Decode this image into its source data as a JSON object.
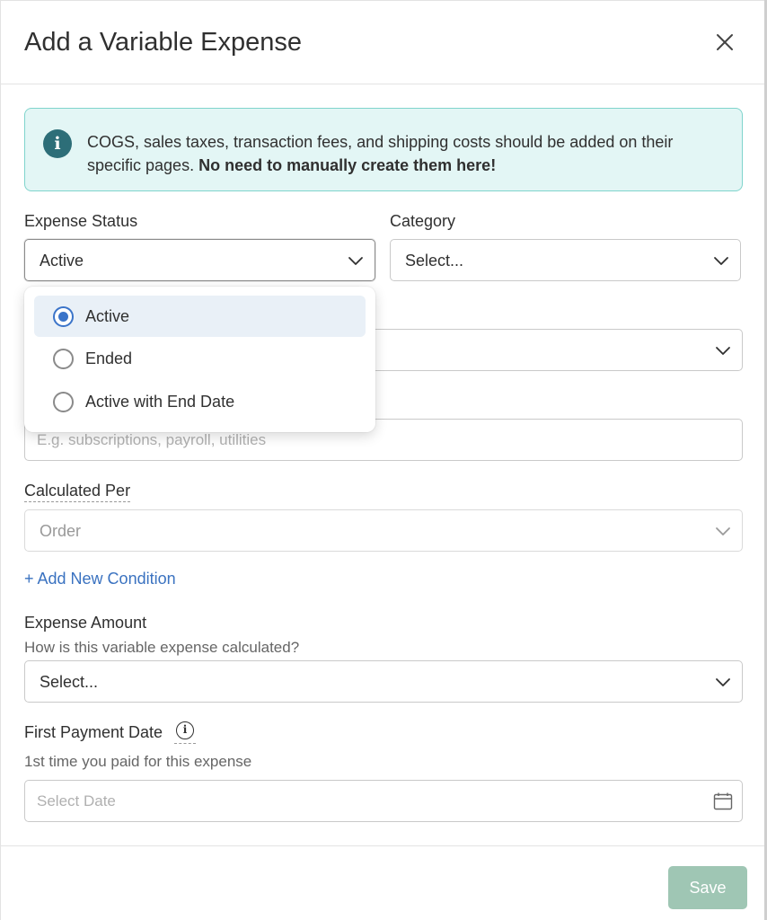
{
  "dialog": {
    "title": "Add a Variable Expense"
  },
  "banner": {
    "text": "COGS, sales taxes, transaction fees, and shipping costs should be added on their specific pages.",
    "bold_text": "No need to manually create them here!",
    "icon": "info-icon"
  },
  "expense_status": {
    "label": "Expense Status",
    "value": "Active",
    "options": [
      {
        "label": "Active",
        "selected": true
      },
      {
        "label": "Ended",
        "selected": false
      },
      {
        "label": "Active with End Date",
        "selected": false
      }
    ]
  },
  "category": {
    "label": "Category",
    "value": "Select..."
  },
  "name_field": {
    "placeholder": "E.g. subscriptions, payroll, utilities"
  },
  "calculated_per": {
    "label": "Calculated Per",
    "value": "Order"
  },
  "add_condition": {
    "label": "+ Add New Condition"
  },
  "expense_amount": {
    "label": "Expense Amount",
    "sublabel": "How is this variable expense calculated?",
    "value": "Select..."
  },
  "first_payment": {
    "label": "First Payment Date",
    "sublabel": "1st time you paid for this expense",
    "placeholder": "Select Date"
  },
  "footer": {
    "save_label": "Save"
  },
  "colors": {
    "banner_bg": "#e3f6f5",
    "banner_border": "#7fd4cc",
    "accent_blue": "#3b74c9",
    "save_button": "#9fc6b4"
  }
}
